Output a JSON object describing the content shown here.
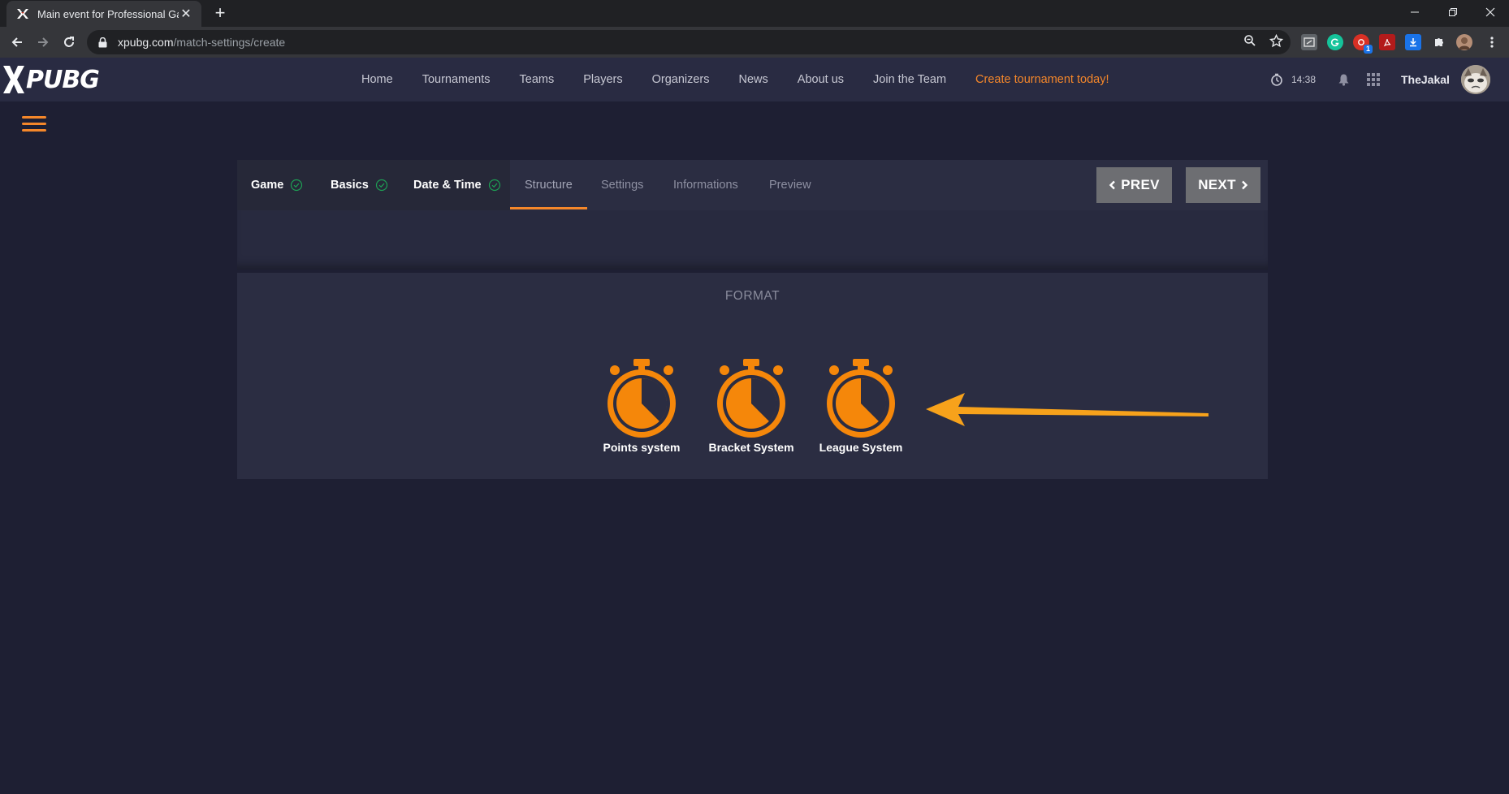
{
  "browser": {
    "tab_title": "Main event for Professional Gam",
    "url_host": "xpubg.com",
    "url_path": "/match-settings/create",
    "new_tab_symbol": "+",
    "close_tab_symbol": "✕",
    "extension_badge": "1"
  },
  "header": {
    "logo_text": "PUBG",
    "nav": [
      "Home",
      "Tournaments",
      "Teams",
      "Players",
      "Organizers",
      "News",
      "About us",
      "Join the Team",
      "Create tournament today!"
    ],
    "clock": "14:38",
    "username": "TheJakal",
    "accent_color": "#f5872a"
  },
  "wizard": {
    "steps": [
      {
        "label": "Game",
        "state": "done"
      },
      {
        "label": "Basics",
        "state": "done"
      },
      {
        "label": "Date & Time",
        "state": "done"
      },
      {
        "label": "Structure",
        "state": "active"
      },
      {
        "label": "Settings",
        "state": "todo"
      },
      {
        "label": "Informations",
        "state": "todo"
      },
      {
        "label": "Preview",
        "state": "todo"
      }
    ],
    "prev_label": "PREV",
    "next_label": "NEXT",
    "format_title": "FORMAT",
    "options": [
      {
        "label": "Points system",
        "icon": "stopwatch-icon"
      },
      {
        "label": "Bracket System",
        "icon": "stopwatch-icon"
      },
      {
        "label": "League System",
        "icon": "stopwatch-icon"
      }
    ]
  }
}
